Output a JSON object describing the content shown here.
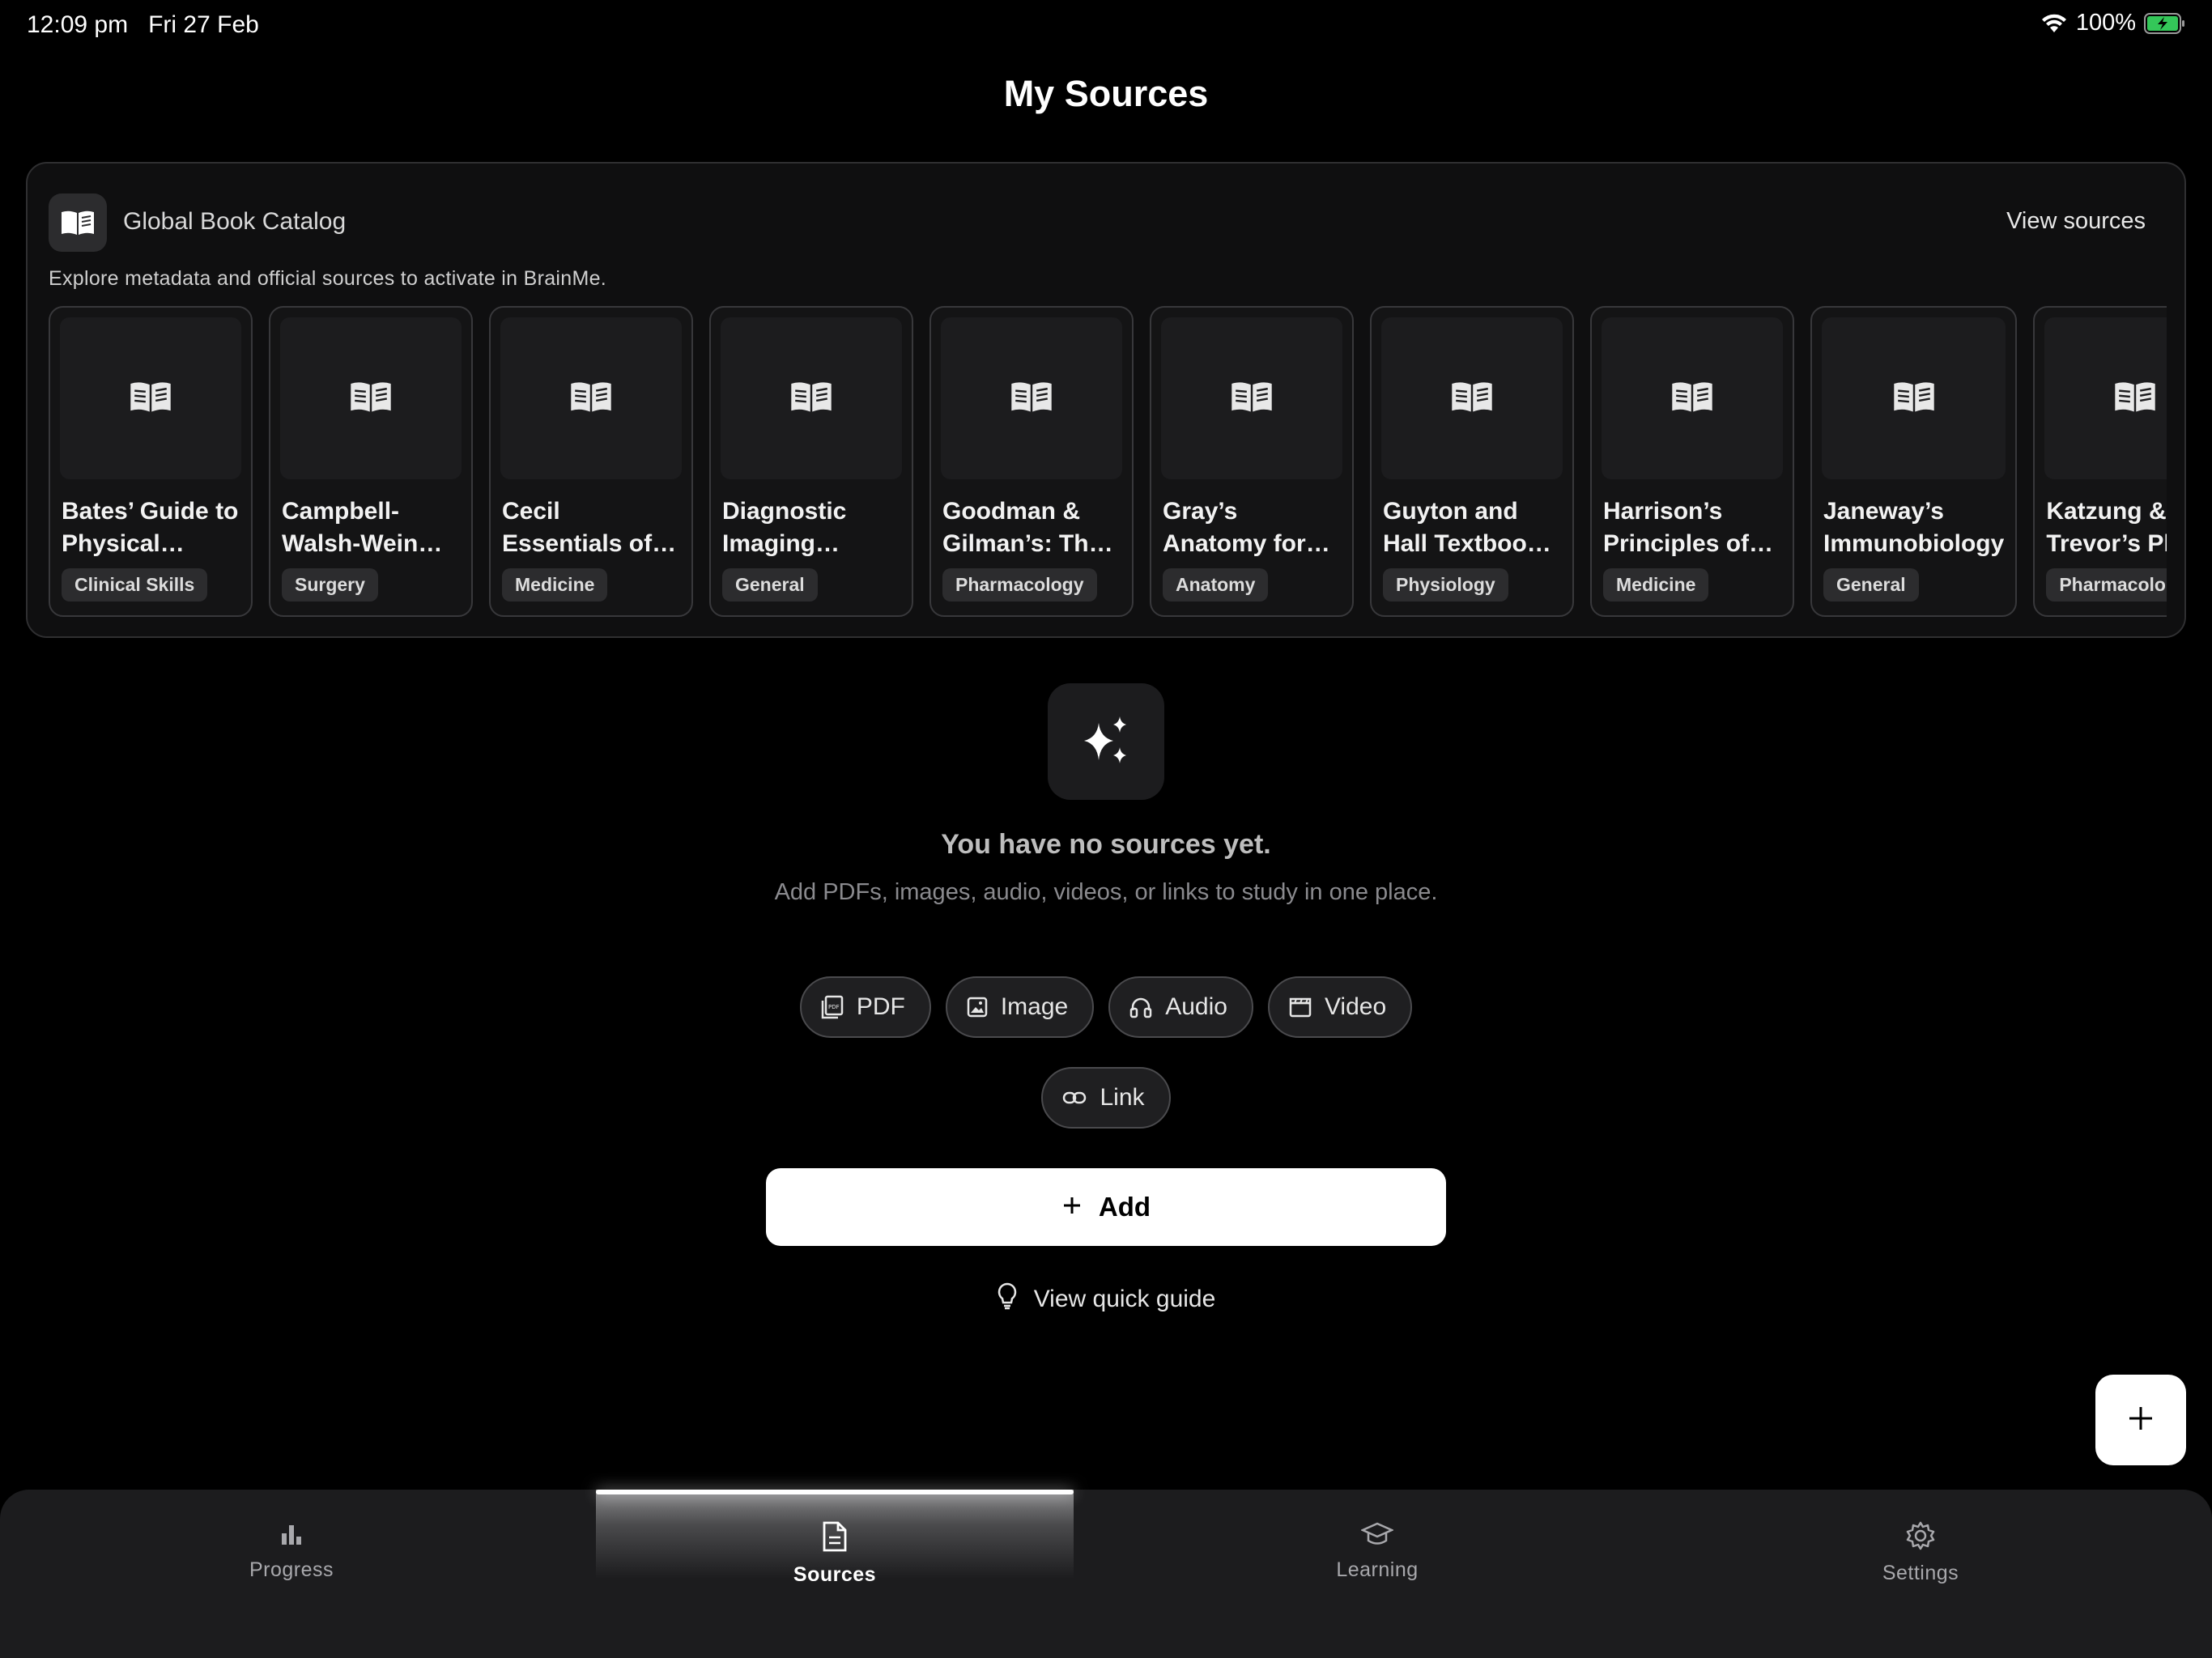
{
  "status": {
    "time": "12:09 pm",
    "date": "Fri 27 Feb",
    "battery": "100%"
  },
  "page_title": "My Sources",
  "catalog": {
    "title": "Global Book Catalog",
    "view_link": "View sources",
    "subtitle": "Explore metadata and official sources to activate in BrainMe.",
    "books": [
      {
        "title": "Bates’ Guide to Physical Exam…",
        "tag": "Clinical Skills"
      },
      {
        "title": "Campbell-Walsh-Wein Ur…",
        "tag": "Surgery"
      },
      {
        "title": "Cecil Essentials of Medicine",
        "tag": "Medicine"
      },
      {
        "title": "Diagnostic Imaging (Radi…",
        "tag": "General"
      },
      {
        "title": "Goodman & Gilman’s: The …",
        "tag": "Pharmacology"
      },
      {
        "title": "Gray’s Anatomy for S…",
        "tag": "Anatomy"
      },
      {
        "title": "Guyton and Hall Textbook …",
        "tag": "Physiology"
      },
      {
        "title": "Harrison’s Principles of I…",
        "tag": "Medicine"
      },
      {
        "title": "Janeway’s Immunobiology",
        "tag": "General"
      },
      {
        "title": "Katzung & Trevor’s Ph",
        "tag": "Pharmacolo"
      }
    ]
  },
  "empty_state": {
    "title": "You have no sources yet.",
    "description": "Add PDFs, images, audio, videos, or links to study in one place.",
    "chips": [
      {
        "label": "PDF",
        "icon": "pdf-icon"
      },
      {
        "label": "Image",
        "icon": "image-icon"
      },
      {
        "label": "Audio",
        "icon": "headphones-icon"
      },
      {
        "label": "Video",
        "icon": "clapperboard-icon"
      },
      {
        "label": "Link",
        "icon": "link-icon"
      }
    ],
    "add_label": "Add",
    "guide_label": "View quick guide"
  },
  "tabs": [
    {
      "label": "Progress",
      "icon": "bar-chart-icon",
      "active": false
    },
    {
      "label": "Sources",
      "icon": "document-icon",
      "active": true
    },
    {
      "label": "Learning",
      "icon": "graduation-cap-icon",
      "active": false
    },
    {
      "label": "Settings",
      "icon": "gear-icon",
      "active": false
    }
  ]
}
